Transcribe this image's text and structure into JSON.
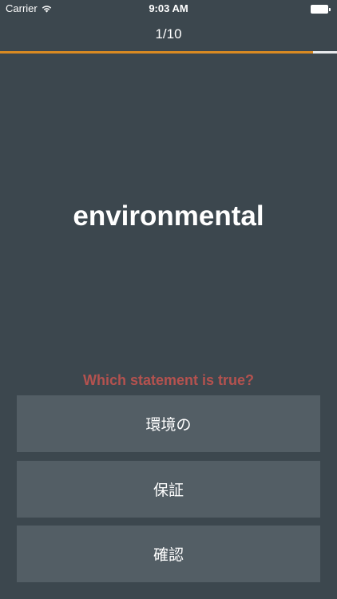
{
  "status_bar": {
    "carrier": "Carrier",
    "wifi_icon": "wifi-icon",
    "time": "9:03 AM",
    "battery_icon": "battery-full-icon"
  },
  "quiz": {
    "counter": "1/10",
    "progress": 0.93,
    "word": "environmental",
    "question": "Which statement is true?",
    "options": [
      {
        "label": "環境の"
      },
      {
        "label": "保証"
      },
      {
        "label": "確認"
      }
    ]
  },
  "colors": {
    "background": "#3c474e",
    "option_background": "#535e65",
    "progress_fill": "#d98a22",
    "progress_track": "#e8eaec",
    "question_text": "#b4524f",
    "text": "#ffffff"
  }
}
